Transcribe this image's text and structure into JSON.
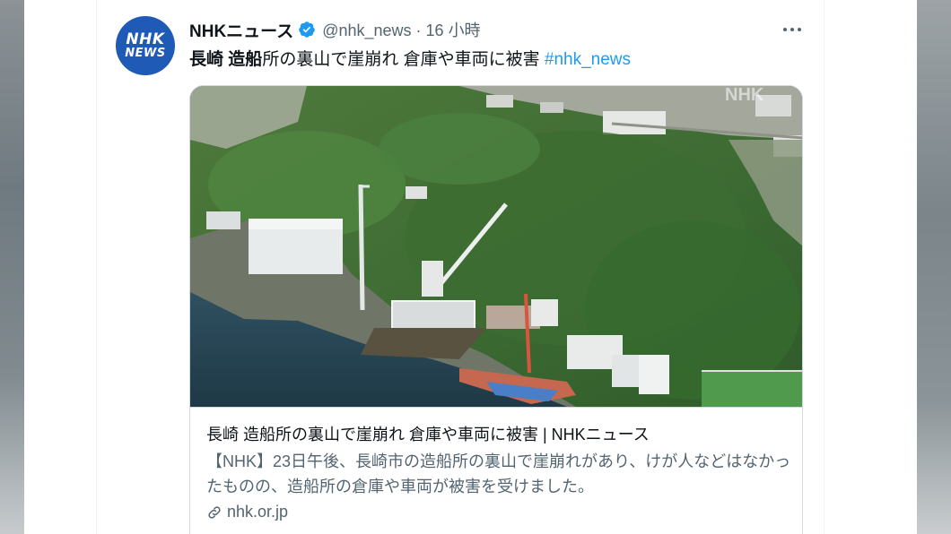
{
  "tweet": {
    "avatar": {
      "line1": "NHK",
      "line2": "NEWS"
    },
    "author_name": "NHKニュース",
    "verified_icon": "verified-badge-icon",
    "handle_time": "@nhk_news · 16 小時",
    "more_icon": "more-horizontal-icon",
    "text_bold1": "長崎",
    "text_bold2": "造船",
    "text_plain": "所の裏山で崖崩れ 倉庫や車両に被害 ",
    "hashtag": "#nhk_news",
    "card": {
      "image_watermark": "NHK",
      "title": "長崎 造船所の裏山で崖崩れ 倉庫や車両に被害 | NHKニュース",
      "description": "【NHK】23日午後、長崎市の造船所の裏山で崖崩れがあり、けが人などはなかったものの、造船所の倉庫や車両が被害を受けました。",
      "link_icon": "link-icon",
      "domain": "nhk.or.jp"
    }
  },
  "colors": {
    "avatar_bg": "#1f5ab7",
    "verified": "#1d9bf0",
    "hashtag": "#1d9bf0",
    "secondary_text": "#536471"
  }
}
